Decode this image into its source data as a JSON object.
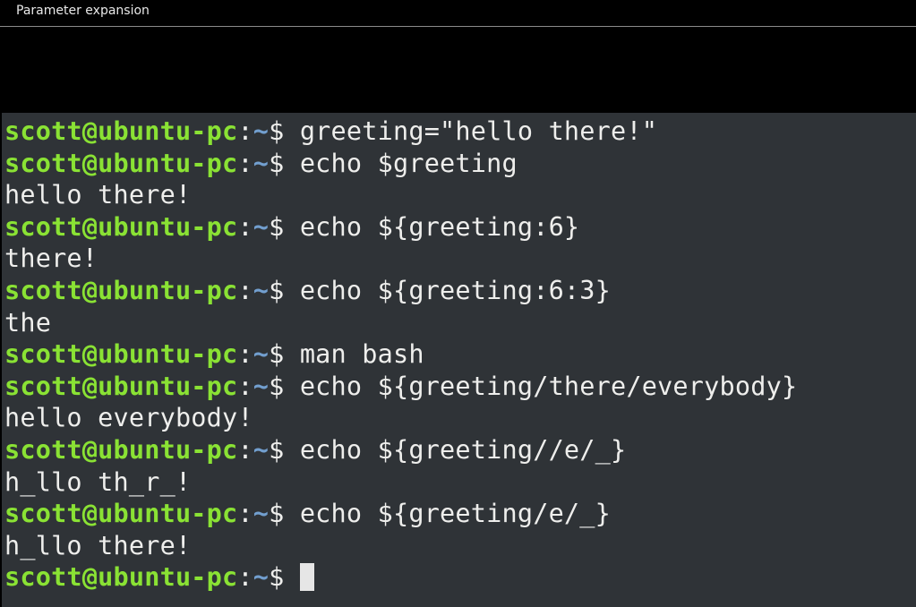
{
  "window": {
    "title": "Parameter expansion"
  },
  "terminal": {
    "prompt": {
      "user_host": "scott@ubuntu-pc",
      "colon": ":",
      "path": "~",
      "symbol": "$ "
    },
    "lines": [
      {
        "type": "command",
        "text": "greeting=\"hello there!\""
      },
      {
        "type": "command",
        "text": "echo $greeting"
      },
      {
        "type": "output",
        "text": "hello there!"
      },
      {
        "type": "command",
        "text": "echo ${greeting:6}"
      },
      {
        "type": "output",
        "text": "there!"
      },
      {
        "type": "command",
        "text": "echo ${greeting:6:3}"
      },
      {
        "type": "output",
        "text": "the"
      },
      {
        "type": "command",
        "text": "man bash"
      },
      {
        "type": "command",
        "text": "echo ${greeting/there/everybody}"
      },
      {
        "type": "output",
        "text": "hello everybody!"
      },
      {
        "type": "command",
        "text": "echo ${greeting//e/_}"
      },
      {
        "type": "output",
        "text": "h_llo th_r_!"
      },
      {
        "type": "command",
        "text": "echo ${greeting/e/_}"
      },
      {
        "type": "output",
        "text": "h_llo there!"
      },
      {
        "type": "prompt",
        "text": ""
      }
    ]
  },
  "colors": {
    "user_host": "#8ae234",
    "path": "#729fcf",
    "background": "#2f3337",
    "text": "#eeeeec"
  }
}
